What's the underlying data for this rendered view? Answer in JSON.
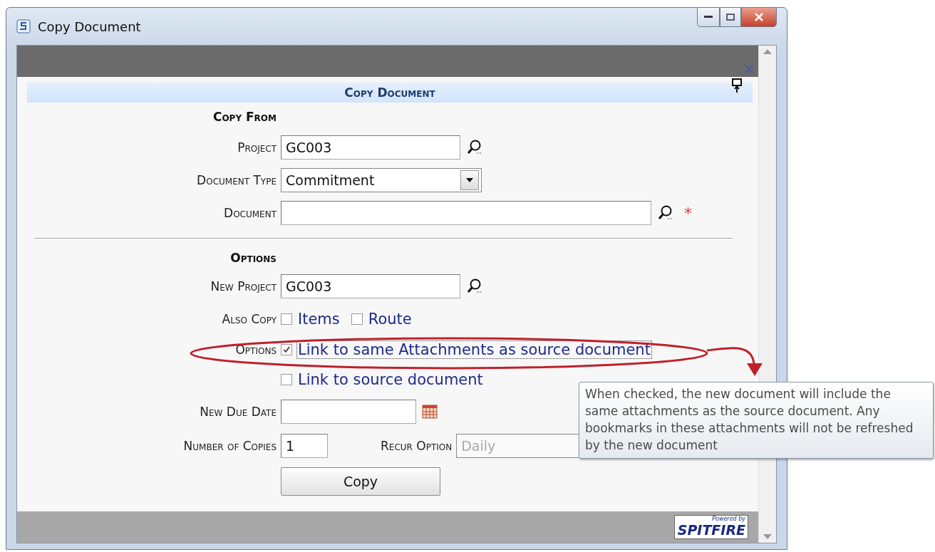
{
  "window": {
    "title": "Copy Document"
  },
  "header": {
    "title": "Copy Document"
  },
  "copy_from": {
    "heading": "Copy From",
    "project": {
      "label": "Project",
      "value": "GC003"
    },
    "document_type": {
      "label": "Document Type",
      "value": "Commitment"
    },
    "document": {
      "label": "Document",
      "required_mark": "*"
    }
  },
  "options": {
    "heading": "Options",
    "new_project": {
      "label": "New Project",
      "value": "GC003"
    },
    "also_copy": {
      "label": "Also Copy",
      "items": [
        {
          "label": "Items",
          "checked": false
        },
        {
          "label": "Route",
          "checked": false
        }
      ]
    },
    "link_options": {
      "label": "Options",
      "items": [
        {
          "label": "Link to same Attachments as source document",
          "checked": true,
          "focused": true
        },
        {
          "label": "Link to source document",
          "checked": false,
          "focused": false
        }
      ]
    },
    "new_due_date": {
      "label": "New Due Date"
    },
    "number_of_copies": {
      "label": "Number of Copies",
      "value": "1"
    },
    "recur_option": {
      "label": "Recur Option",
      "value": "Daily",
      "disabled": true
    }
  },
  "copy_button": "Copy",
  "footer": {
    "logo_top": "Powered by",
    "logo_main": "SPITFIRE"
  },
  "tooltip": {
    "text": "When checked, the new document will include the same attachments as the source document. Any bookmarks in these attachments will not be refreshed by the new document"
  }
}
